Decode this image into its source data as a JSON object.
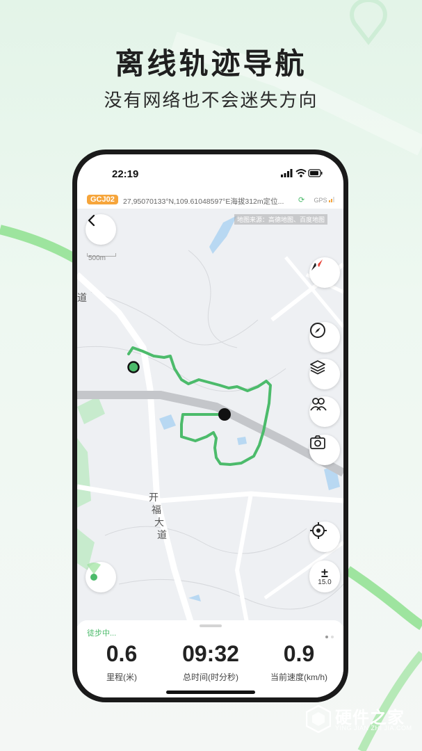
{
  "promo": {
    "headline": "离线轨迹导航",
    "subline": "没有网络也不会迷失方向"
  },
  "status_bar": {
    "time": "22:19"
  },
  "coord_bar": {
    "badge": "GCJ02",
    "text": "27,95070133°N,109.61048597°E海拔312m定位...",
    "gps": "GPS"
  },
  "map": {
    "source": "地图来源：高德地图、百度地图",
    "scale": "500m",
    "road_labels": [
      "道",
      "开",
      "福",
      "大",
      "道"
    ]
  },
  "controls": {
    "back": "back-icon",
    "compass": "compass-icon",
    "navigation": "navigate-icon",
    "layers": "layers-icon",
    "team": "team-icon",
    "camera": "camera-icon",
    "locate": "locate-icon",
    "zoom_symbol": "±",
    "zoom_level": "15.0"
  },
  "panel": {
    "status": "徒步中...",
    "stats": [
      {
        "value": "0.6",
        "label": "里程(米)"
      },
      {
        "value": "09:32",
        "label": "总时间(时分秒)"
      },
      {
        "value": "0.9",
        "label": "当前速度(km/h)"
      }
    ]
  },
  "colors": {
    "accent": "#4cbb6b",
    "badge": "#f6a53b",
    "map_bg": "#eef0f3"
  },
  "watermark": {
    "name": "硬件之家",
    "sub": "YING JIAN ZHI JIA.COM"
  }
}
